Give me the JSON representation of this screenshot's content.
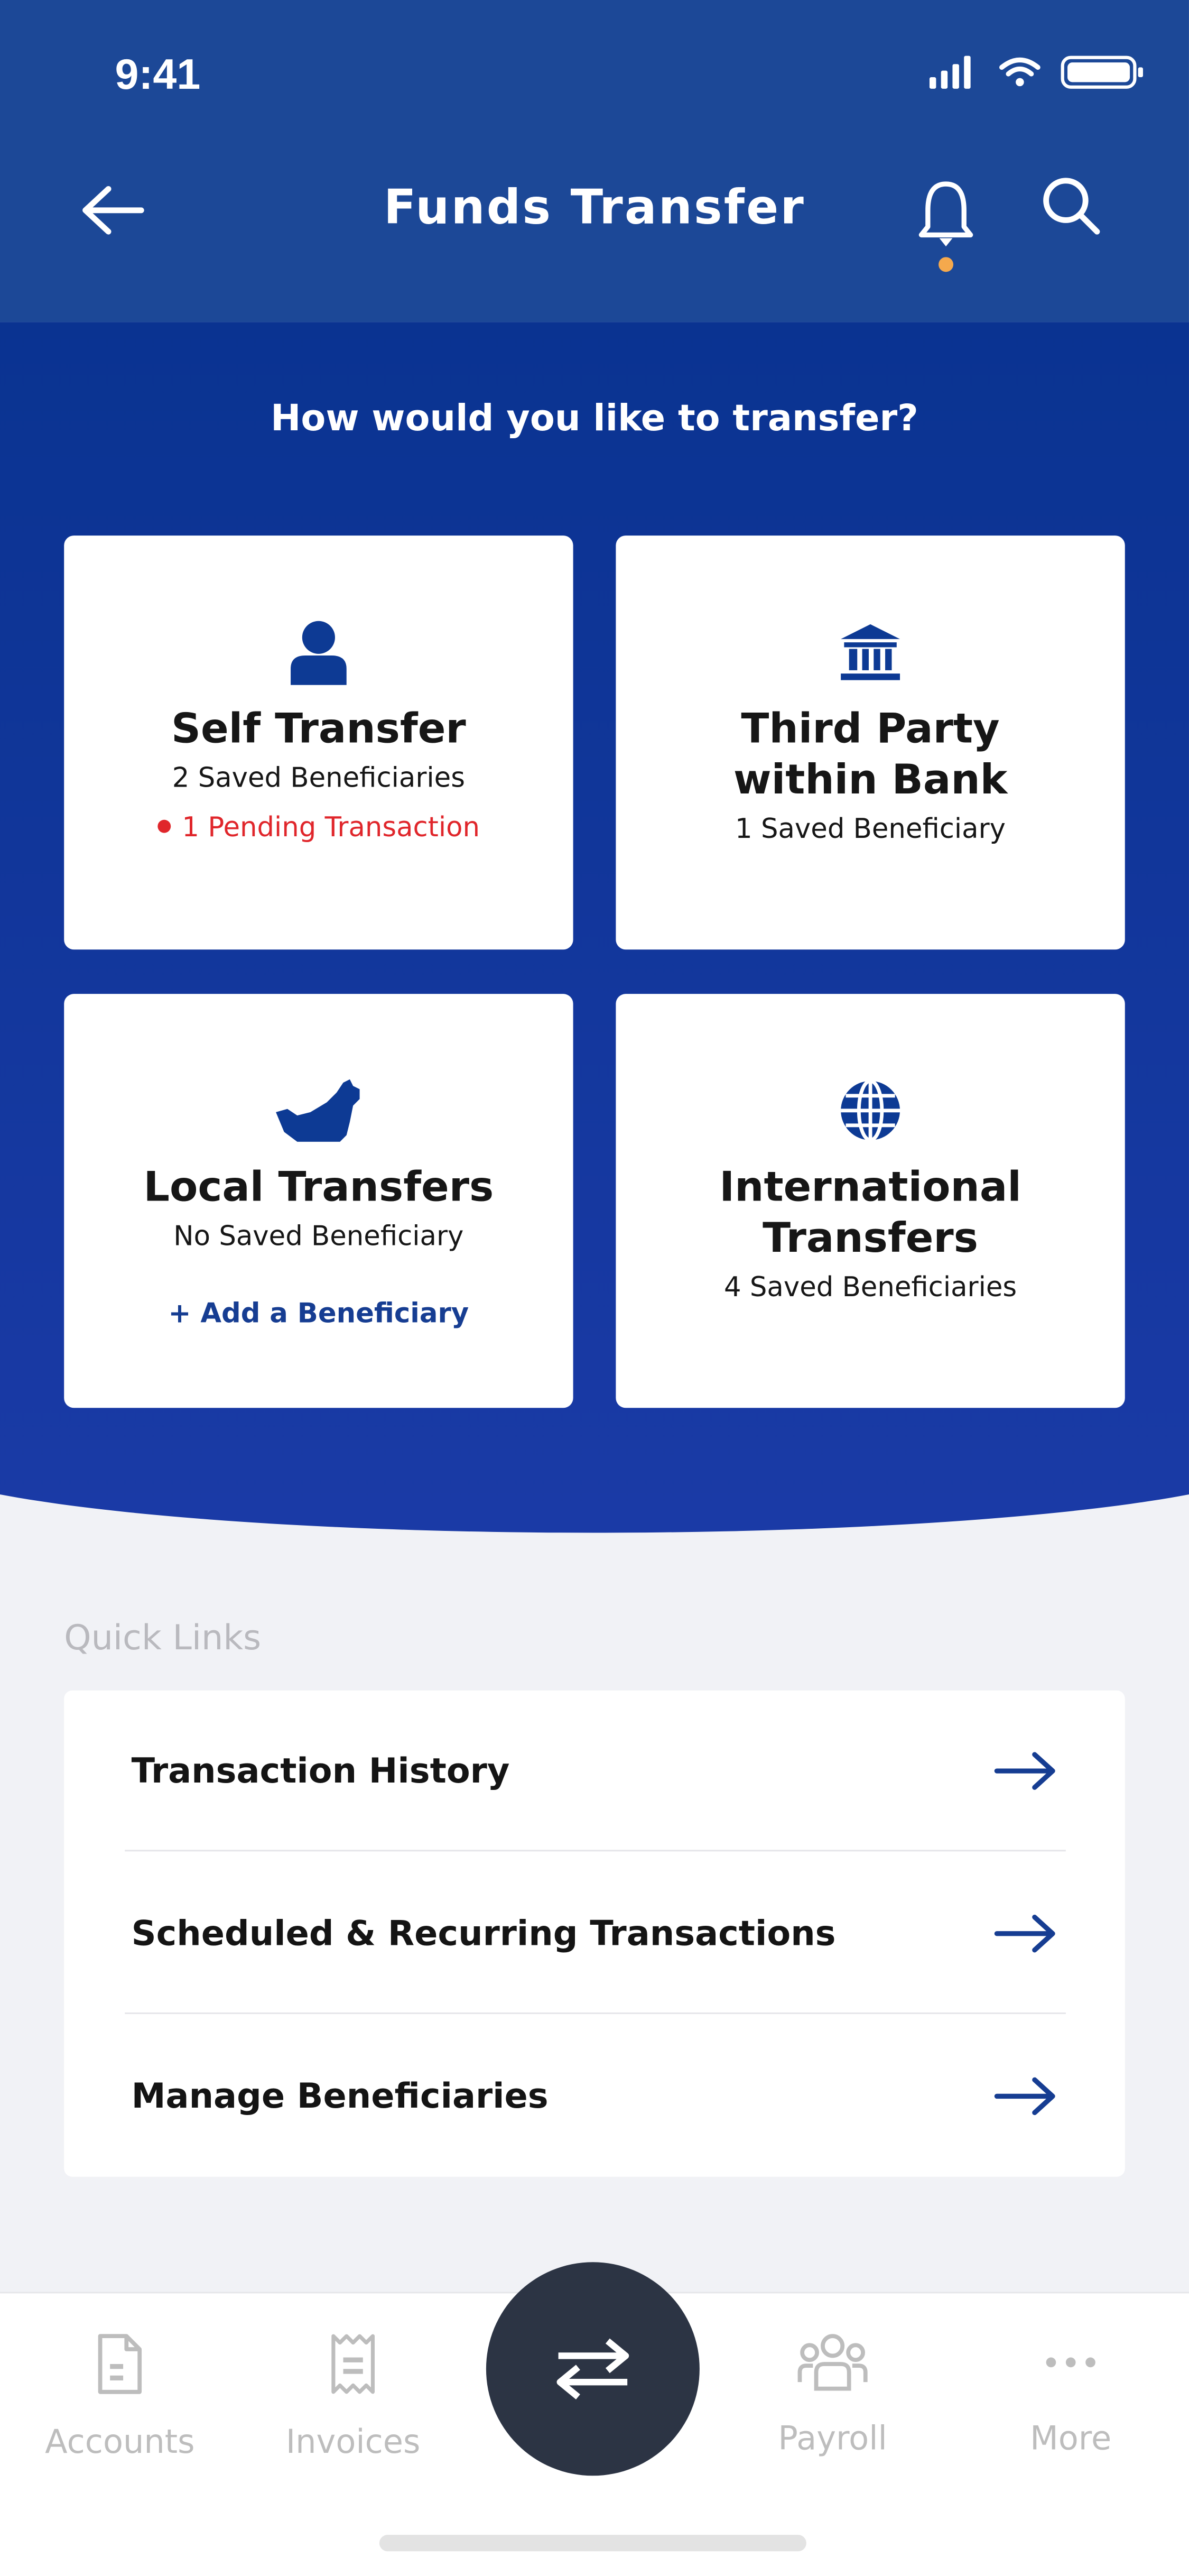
{
  "status_bar": {
    "time": "9:41",
    "icons": [
      "signal-icon",
      "wifi-icon",
      "battery-icon"
    ]
  },
  "header": {
    "title": "Funds Transfer",
    "notification_dot_color": "#f5a94d"
  },
  "main": {
    "question": "How would you like to transfer?",
    "cards": [
      {
        "title": "Self Transfer",
        "subtitle": "2 Saved Beneficiaries",
        "alert": "1 Pending Transaction",
        "icon": "person-icon"
      },
      {
        "title_line1": "Third Party",
        "title_line2": "within Bank",
        "subtitle": "1 Saved Beneficiary",
        "icon": "bank-icon"
      },
      {
        "title": "Local Transfers",
        "subtitle": "No Saved Beneficiary",
        "action": "+ Add a Beneficiary",
        "icon": "uae-map-icon"
      },
      {
        "title_line1": "International",
        "title_line2": "Transfers",
        "subtitle": "4 Saved Beneficiaries",
        "icon": "globe-icon"
      }
    ]
  },
  "quick_links": {
    "heading": "Quick Links",
    "items": [
      {
        "label": "Transaction History"
      },
      {
        "label": "Scheduled & Recurring Transactions"
      },
      {
        "label": "Manage Beneficiaries"
      }
    ]
  },
  "tab_bar": {
    "items": [
      {
        "label": "Accounts",
        "icon": "document-icon"
      },
      {
        "label": "Invoices",
        "icon": "receipt-icon"
      },
      {
        "label": "",
        "icon": "transfer-icon"
      },
      {
        "label": "Payroll",
        "icon": "group-icon"
      },
      {
        "label": "More",
        "icon": "more-icon"
      }
    ]
  },
  "colors": {
    "brand_blue": "#0a3391",
    "header_blue": "#1c4897",
    "alert_red": "#e0262b",
    "link_blue": "#163d92",
    "fab": "#2c3444"
  }
}
